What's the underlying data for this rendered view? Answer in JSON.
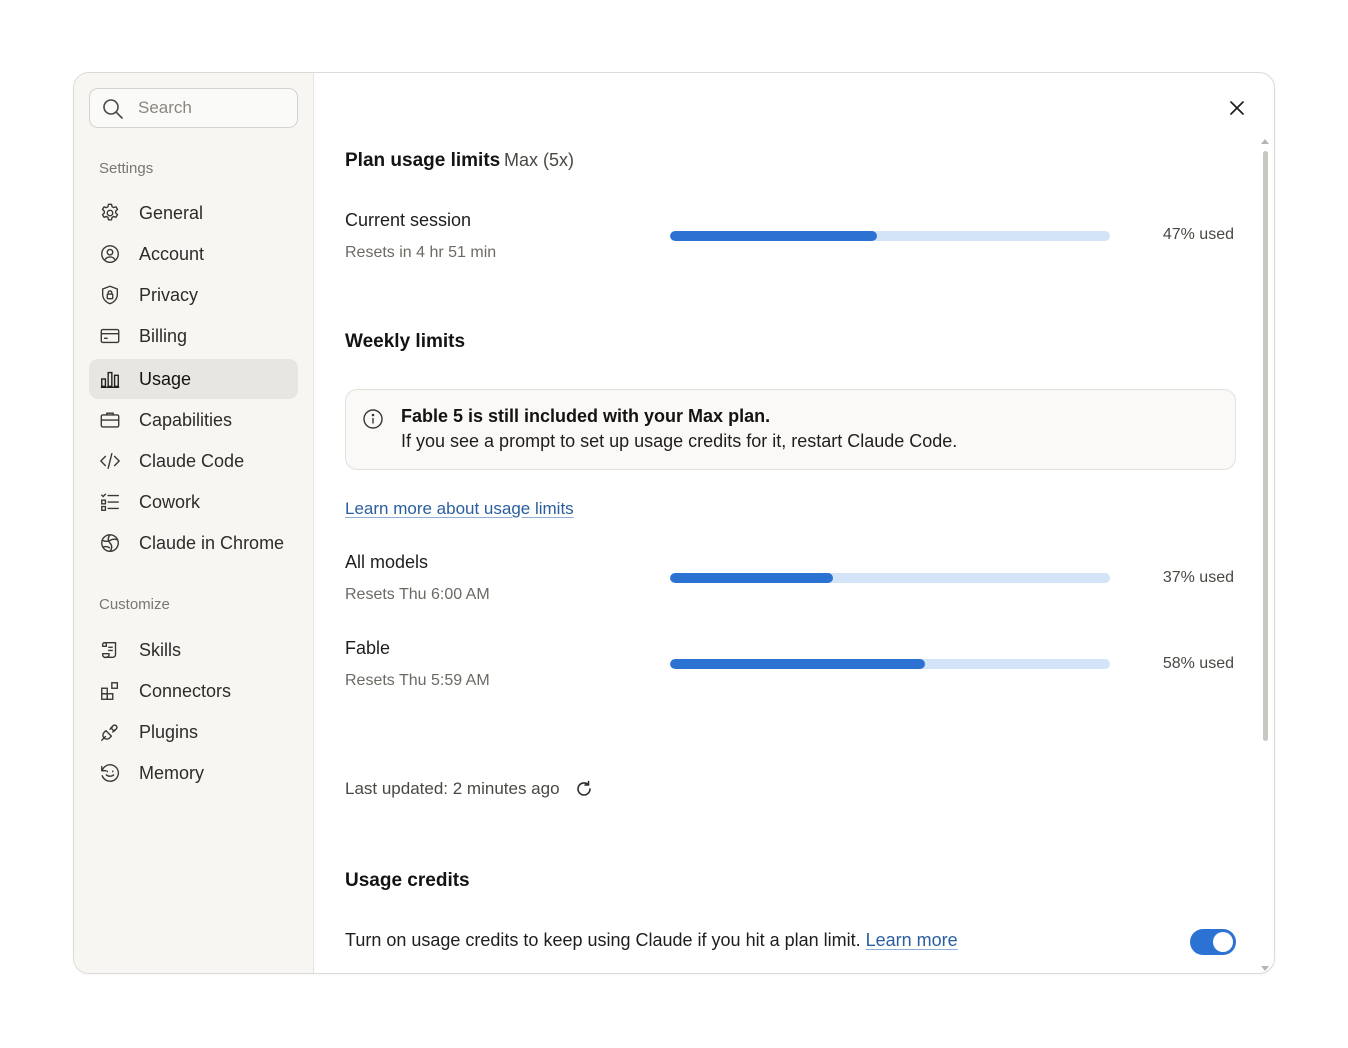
{
  "search": {
    "placeholder": "Search"
  },
  "sidebar": {
    "settings_label": "Settings",
    "settings_items": [
      {
        "label": "General",
        "icon": "gear-icon"
      },
      {
        "label": "Account",
        "icon": "user-circle-icon"
      },
      {
        "label": "Privacy",
        "icon": "shield-icon"
      },
      {
        "label": "Billing",
        "icon": "credit-card-icon"
      },
      {
        "label": "Usage",
        "icon": "bar-chart-icon",
        "active": true
      },
      {
        "label": "Capabilities",
        "icon": "briefcase-icon"
      },
      {
        "label": "Claude Code",
        "icon": "code-icon"
      },
      {
        "label": "Cowork",
        "icon": "checklist-icon"
      },
      {
        "label": "Claude in Chrome",
        "icon": "globe-icon"
      }
    ],
    "customize_label": "Customize",
    "customize_items": [
      {
        "label": "Skills",
        "icon": "scroll-icon"
      },
      {
        "label": "Connectors",
        "icon": "blocks-icon"
      },
      {
        "label": "Plugins",
        "icon": "plug-icon"
      },
      {
        "label": "Memory",
        "icon": "memory-icon"
      }
    ]
  },
  "main": {
    "plan_title": "Plan usage limits",
    "plan_name": "Max (5x)",
    "current_session": {
      "title": "Current session",
      "sub": "Resets in 4 hr 51 min",
      "percent": 47,
      "pct_label": "47% used"
    },
    "weekly_title": "Weekly limits",
    "info": {
      "line1": "Fable 5 is still included with your Max plan.",
      "line2": "If you see a prompt to set up usage credits for it, restart Claude Code."
    },
    "learn_link": "Learn more about usage limits",
    "all_models": {
      "title": "All models",
      "sub": "Resets Thu 6:00 AM",
      "percent": 37,
      "pct_label": "37% used"
    },
    "fable": {
      "title": "Fable",
      "sub": "Resets Thu 5:59 AM",
      "percent": 58,
      "pct_label": "58% used"
    },
    "last_updated": "Last updated: 2 minutes ago",
    "credits_title": "Usage credits",
    "credits_text": "Turn on usage credits to keep using Claude if you hit a plan limit.",
    "credits_link": "Learn more",
    "credits_enabled": true
  },
  "colors": {
    "accent": "#2c72d2",
    "bar_track": "#d3e4f8",
    "sidebar_bg": "#f7f6f3",
    "active_item_bg": "#e8e6e1"
  }
}
